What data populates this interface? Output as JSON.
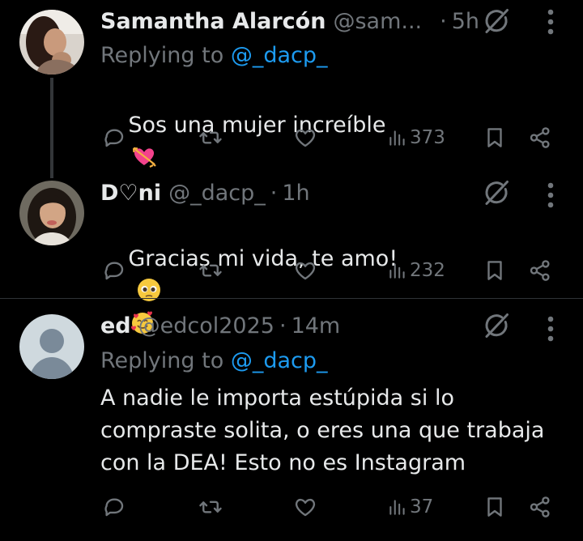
{
  "colors": {
    "background": "#000000",
    "text": "#e7e9ea",
    "secondary": "#71767b",
    "link": "#1d9bf0",
    "divider": "#2f3336"
  },
  "tweets": [
    {
      "name": "Samantha Alarcón",
      "handle": "@sam...",
      "separator": "·",
      "time": "5h",
      "replying_label": "Replying to",
      "replying_to": "@_dacp_",
      "text": "Sos una mujer increíble",
      "emojis": [
        "heart-with-arrow"
      ],
      "views": "373",
      "icons": [
        "reply-icon",
        "retweet-icon",
        "like-icon",
        "views-icon",
        "bookmark-icon",
        "share-icon",
        "grok-icon",
        "more-icon"
      ]
    },
    {
      "name": "D♡ni",
      "handle": "@_dacp_",
      "separator": "·",
      "time": "1h",
      "text": "Gracias mi vida, te amo!",
      "emojis": [
        "pleading-face",
        "smiling-face-with-hearts"
      ],
      "views": "232"
    },
    {
      "name": "ed",
      "handle": "@edcol2025",
      "separator": "·",
      "time": "14m",
      "replying_label": "Replying to",
      "replying_to": "@_dacp_",
      "text": "A nadie le importa estúpida si lo\ncompraste solita, o eres una que trabaja\ncon la DEA! Esto no es Instagram",
      "views": "37"
    }
  ]
}
